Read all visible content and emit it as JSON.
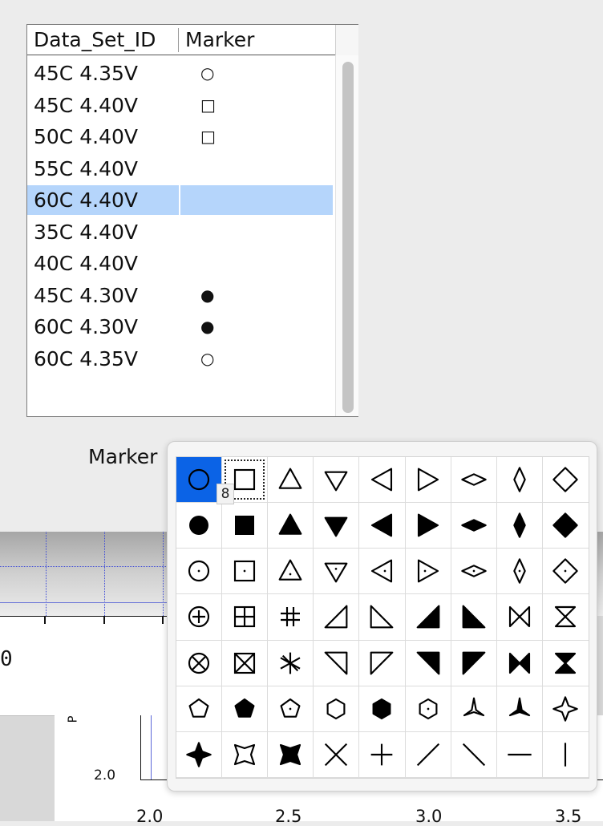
{
  "table": {
    "headers": [
      "Data_Set_ID",
      "Marker"
    ],
    "rows": [
      {
        "id": "45C 4.35V",
        "marker": "○"
      },
      {
        "id": "45C 4.40V",
        "marker": "□"
      },
      {
        "id": "50C 4.40V",
        "marker": "□"
      },
      {
        "id": "55C 4.40V",
        "marker": ""
      },
      {
        "id": "60C 4.40V",
        "marker": "",
        "selected": true
      },
      {
        "id": "35C 4.40V",
        "marker": ""
      },
      {
        "id": "40C 4.40V",
        "marker": ""
      },
      {
        "id": "45C 4.30V",
        "marker": "●"
      },
      {
        "id": "60C 4.30V",
        "marker": "●"
      },
      {
        "id": "60C 4.35V",
        "marker": "○"
      }
    ]
  },
  "marker_label": "Marker",
  "tooltip": "8",
  "marker_grid": [
    [
      "circle-open",
      "square-open",
      "triangle-up-open",
      "triangle-down-open",
      "triangle-left-open",
      "triangle-right-open",
      "diamond-wide-open",
      "diamond-tall-open",
      "diamond-open"
    ],
    [
      "circle-filled",
      "square-filled",
      "triangle-up-filled",
      "triangle-down-filled",
      "triangle-left-filled",
      "triangle-right-filled",
      "diamond-wide-filled",
      "diamond-tall-filled",
      "diamond-filled"
    ],
    [
      "circle-dot",
      "square-dot",
      "triangle-up-dot",
      "triangle-down-dot",
      "triangle-left-dot",
      "triangle-right-dot",
      "diamond-wide-dot",
      "diamond-tall-dot",
      "diamond-dot"
    ],
    [
      "circle-plus",
      "square-plus",
      "hash",
      "right-triangle-open-1",
      "right-triangle-open-2",
      "right-triangle-filled-1",
      "right-triangle-filled-2",
      "bowtie-open",
      "hourglass-open"
    ],
    [
      "circle-x",
      "square-x",
      "asterisk",
      "right-triangle-open-3",
      "right-triangle-open-4",
      "right-triangle-filled-3",
      "right-triangle-filled-4",
      "bowtie-filled",
      "hourglass-filled"
    ],
    [
      "pentagon-open",
      "pentagon-filled",
      "pentagon-dot",
      "hexagon-open",
      "hexagon-filled",
      "hexagon-dot",
      "tristar-open",
      "tristar-filled",
      "star4-open"
    ],
    [
      "star4-filled",
      "square-concave-open",
      "square-concave-filled",
      "x-cross",
      "plus-cross",
      "slash",
      "backslash",
      "horizontal-line",
      "vertical-line"
    ]
  ],
  "selected_marker": "circle-open",
  "focused_marker": "square-open",
  "plot": {
    "y_tick": "2.0",
    "x_ticks": [
      "2.0",
      "2.5",
      "3.0",
      "3.5"
    ],
    "partial_value": "0",
    "ylabel_fragment": "P"
  },
  "colors": {
    "selection": "#b5d5fb",
    "popup_selected": "#0b63e6",
    "grid_line": "#3b49d6"
  }
}
